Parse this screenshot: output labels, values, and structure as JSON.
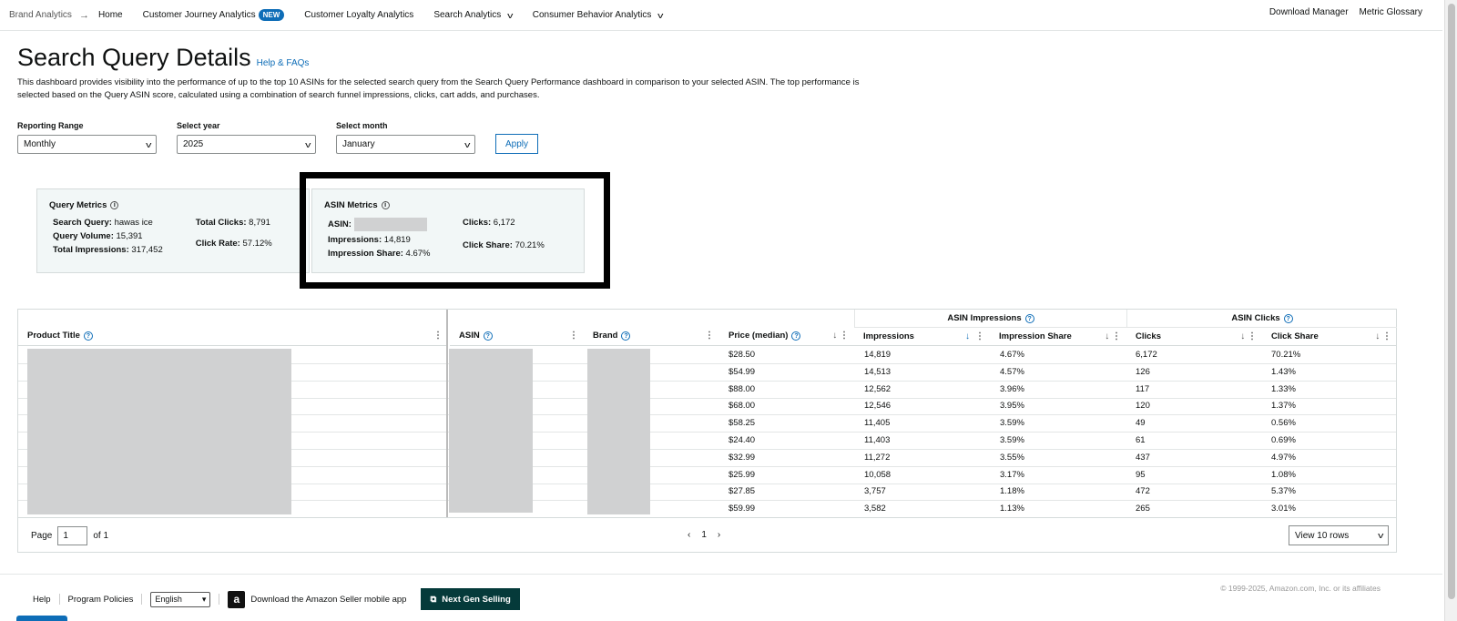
{
  "topnav": {
    "crumb": "Brand Analytics",
    "items": [
      "Home",
      "Customer Journey Analytics",
      "Customer Loyalty Analytics",
      "Search Analytics",
      "Consumer Behavior Analytics"
    ],
    "new_badge": "NEW",
    "right": [
      "Download Manager",
      "Metric Glossary"
    ]
  },
  "page": {
    "title": "Search Query Details",
    "help_link": "Help & FAQs",
    "description": "This dashboard provides visibility into the performance of up to the top 10 ASINs for the selected search query from the Search Query Performance dashboard in comparison to your selected ASIN. The top performance is selected based on the Query ASIN score, calculated using a combination of search funnel impressions, clicks, cart adds, and purchases."
  },
  "filters": {
    "range_label": "Reporting Range",
    "range_value": "Monthly",
    "year_label": "Select year",
    "year_value": "2025",
    "month_label": "Select month",
    "month_value": "January",
    "apply": "Apply"
  },
  "query_metrics": {
    "title": "Query Metrics",
    "search_query_label": "Search Query:",
    "search_query": "hawas ice",
    "query_volume_label": "Query Volume:",
    "query_volume": "15,391",
    "total_impr_label": "Total Impressions:",
    "total_impr": "317,452",
    "total_clicks_label": "Total Clicks:",
    "total_clicks": "8,791",
    "click_rate_label": "Click Rate:",
    "click_rate": "57.12%"
  },
  "asin_metrics": {
    "title": "ASIN Metrics",
    "asin_label": "ASIN:",
    "impr_label": "Impressions:",
    "impr": "14,819",
    "impr_share_label": "Impression Share:",
    "impr_share": "4.67%",
    "clicks_label": "Clicks:",
    "clicks": "6,172",
    "click_share_label": "Click Share:",
    "click_share": "70.21%"
  },
  "table": {
    "group_impr": "ASIN Impressions",
    "group_clicks": "ASIN Clicks",
    "headers": {
      "product_title": "Product Title",
      "asin": "ASIN",
      "brand": "Brand",
      "price": "Price (median)",
      "impressions": "Impressions",
      "impression_share": "Impression Share",
      "clicks": "Clicks",
      "click_share": "Click Share"
    },
    "rows": [
      {
        "price": "$28.50",
        "impr": "14,819",
        "share": "4.67%",
        "clicks": "6,172",
        "cshare": "70.21%"
      },
      {
        "price": "$54.99",
        "impr": "14,513",
        "share": "4.57%",
        "clicks": "126",
        "cshare": "1.43%"
      },
      {
        "price": "$88.00",
        "impr": "12,562",
        "share": "3.96%",
        "clicks": "117",
        "cshare": "1.33%"
      },
      {
        "price": "$68.00",
        "impr": "12,546",
        "share": "3.95%",
        "clicks": "120",
        "cshare": "1.37%"
      },
      {
        "price": "$58.25",
        "impr": "11,405",
        "share": "3.59%",
        "clicks": "49",
        "cshare": "0.56%"
      },
      {
        "price": "$24.40",
        "impr": "11,403",
        "share": "3.59%",
        "clicks": "61",
        "cshare": "0.69%"
      },
      {
        "price": "$32.99",
        "impr": "11,272",
        "share": "3.55%",
        "clicks": "437",
        "cshare": "4.97%"
      },
      {
        "price": "$25.99",
        "impr": "10,058",
        "share": "3.17%",
        "clicks": "95",
        "cshare": "1.08%"
      },
      {
        "price": "$27.85",
        "impr": "3,757",
        "share": "1.18%",
        "clicks": "472",
        "cshare": "5.37%"
      },
      {
        "price": "$59.99",
        "impr": "3,582",
        "share": "1.13%",
        "clicks": "265",
        "cshare": "3.01%"
      }
    ],
    "pager": {
      "page_label": "Page",
      "page_value": "1",
      "of": "of 1",
      "current": "1",
      "rows_select": "View 10 rows"
    }
  },
  "footer": {
    "help": "Help",
    "policies": "Program Policies",
    "language": "English",
    "app": "Download the Amazon Seller mobile app",
    "next_gen": "Next Gen Selling",
    "copyright": "© 1999-2025, Amazon.com, Inc. or its affiliates"
  }
}
